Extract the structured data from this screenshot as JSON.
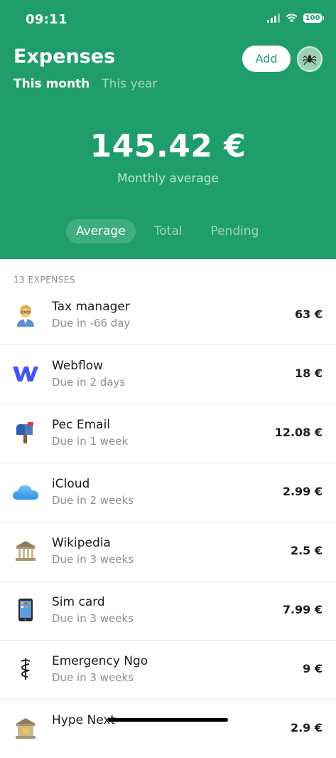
{
  "status_bar": {
    "time": "09:11",
    "battery": "100"
  },
  "header": {
    "title": "Expenses",
    "add_label": "Add",
    "period_tabs": [
      {
        "label": "This month",
        "active": true
      },
      {
        "label": "This year",
        "active": false
      }
    ],
    "amount": "145.42 €",
    "amount_caption": "Monthly average",
    "segments": [
      {
        "label": "Average",
        "active": true
      },
      {
        "label": "Total",
        "active": false
      },
      {
        "label": "Pending",
        "active": false
      }
    ]
  },
  "colors": {
    "brand_green": "#1f9e6b",
    "text_primary": "#1c1c1e",
    "text_secondary": "#8e8e93"
  },
  "list": {
    "header": "13 EXPENSES",
    "items": [
      {
        "icon": "tax-manager-icon",
        "name": "Tax manager",
        "due": "Due in -66 day",
        "amount": "63 €"
      },
      {
        "icon": "webflow-icon",
        "name": "Webflow",
        "due": "Due in 2 days",
        "amount": "18 €"
      },
      {
        "icon": "mailbox-icon",
        "name": "Pec Email",
        "due": "Due in 1 week",
        "amount": "12.08 €"
      },
      {
        "icon": "cloud-icon",
        "name": "iCloud",
        "due": "Due in 2 weeks",
        "amount": "2.99 €"
      },
      {
        "icon": "bank-icon",
        "name": "Wikipedia",
        "due": "Due in 3 weeks",
        "amount": "2.5 €"
      },
      {
        "icon": "phone-icon",
        "name": "Sim card",
        "due": "Due in 3 weeks",
        "amount": "7.99 €"
      },
      {
        "icon": "medical-icon",
        "name": "Emergency  Ngo",
        "due": "Due in 3 weeks",
        "amount": "9 €"
      },
      {
        "icon": "bank-money-icon",
        "name": "Hype Next",
        "due": "",
        "amount": "2.9 €"
      }
    ]
  }
}
